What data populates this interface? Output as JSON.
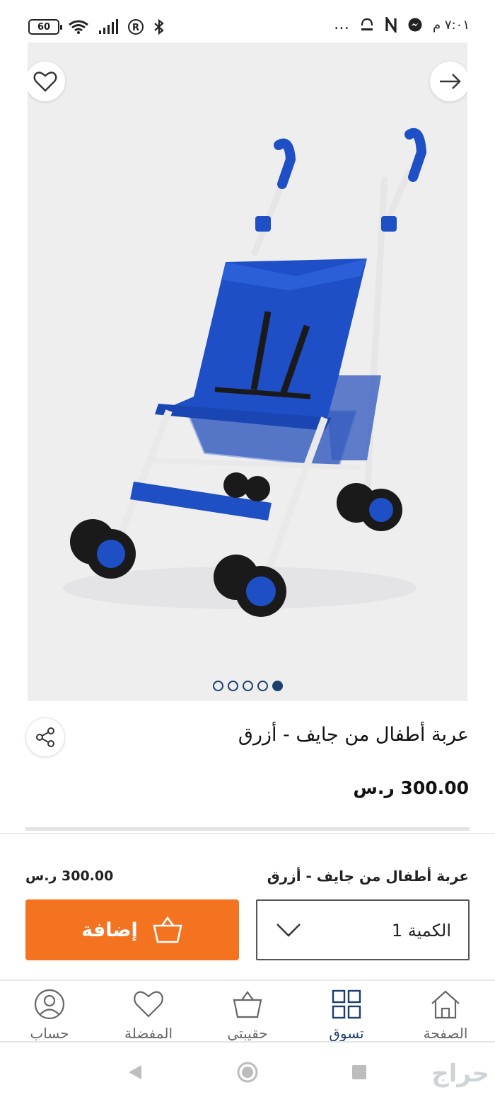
{
  "status_bar": {
    "battery": "60",
    "time": "٧:٠١ م",
    "overflow": "…"
  },
  "gallery": {
    "dots_count": 5,
    "active_dot": 4
  },
  "product": {
    "title": "عربة أطفال من جايف - أزرق",
    "price": "300.00 ر.س"
  },
  "cart_panel": {
    "name": "عربة أطفال من جايف - أزرق",
    "price": "300.00 ر.س",
    "add_label": "إضافة",
    "quantity_label": "الكمية 1"
  },
  "bottom_nav": {
    "items": [
      {
        "label": "حساب",
        "icon": "user-icon"
      },
      {
        "label": "المفضلة",
        "icon": "heart-icon"
      },
      {
        "label": "حقيبتي",
        "icon": "bag-icon"
      },
      {
        "label": "تسوق",
        "icon": "grid-icon"
      },
      {
        "label": "الصفحة",
        "icon": "home-icon"
      }
    ],
    "active": "تسوق"
  },
  "watermark": "حراج",
  "colors": {
    "accent_orange": "#f47321",
    "navy": "#1c3f6e",
    "stroller_blue": "#1f4fc4"
  }
}
